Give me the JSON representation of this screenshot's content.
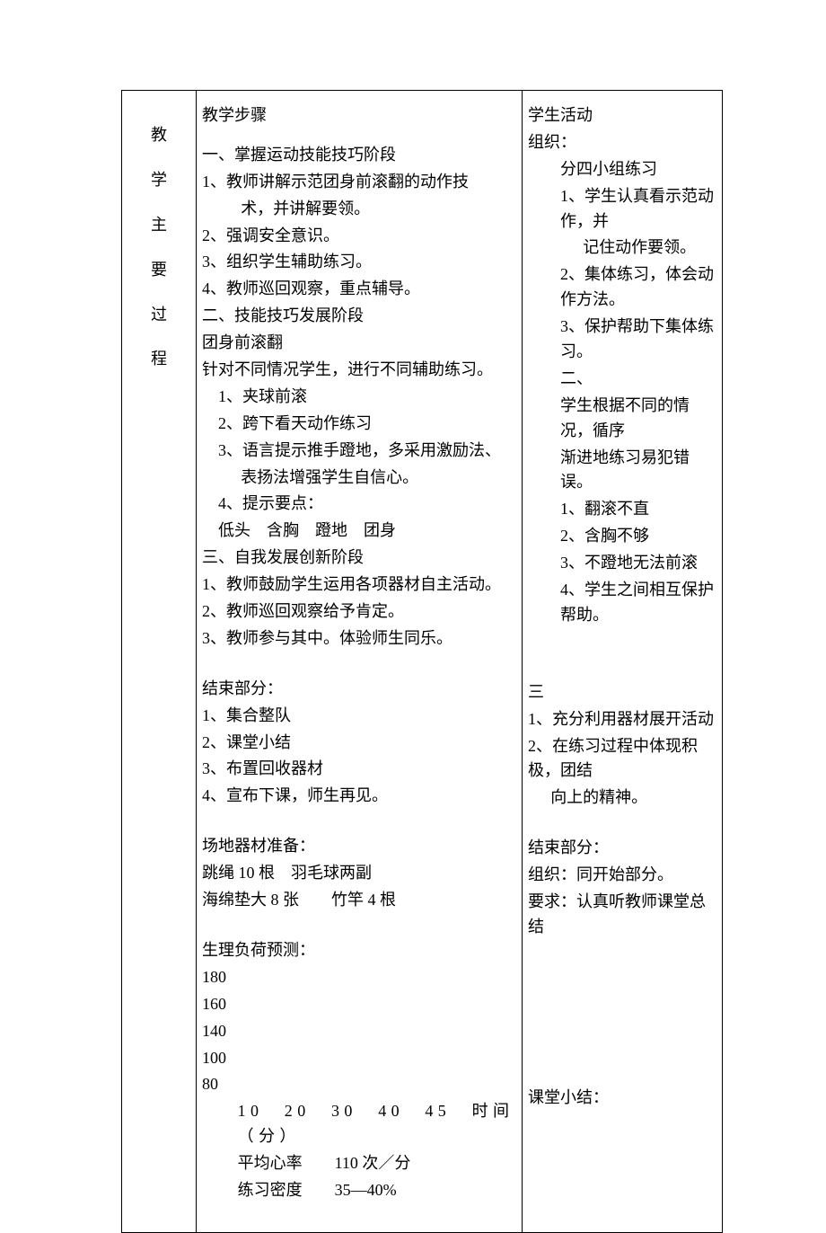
{
  "side": {
    "c1": "教",
    "c2": "学",
    "c3": "主",
    "c4": "要",
    "c5": "过",
    "c6": "程"
  },
  "mid": {
    "h_steps": "教学步骤",
    "s1_title": "一、掌握运动技能技巧阶段",
    "s1_1a": "1、教师讲解示范团身前滚翻的动作技",
    "s1_1b": "术，并讲解要领。",
    "s1_2": "2、强调安全意识。",
    "s1_3": "3、组织学生辅助练习。",
    "s1_4": "4、教师巡回观察，重点辅导。",
    "s2_title": "二、技能技巧发展阶段",
    "s2_sub": "团身前滚翻",
    "s2_intro": "针对不同情况学生，进行不同辅助练习。",
    "s2_1": "1、夹球前滚",
    "s2_2": "2、跨下看天动作练习",
    "s2_3a": "3、语言提示推手蹬地，多采用激励法、",
    "s2_3b": "表扬法增强学生自信心。",
    "s2_4": "4、提示要点：",
    "s2_points": "低头　含胸　蹬地　团身",
    "s3_title": "三、自我发展创新阶段",
    "s3_1": "1、教师鼓励学生运用各项器材自主活动。",
    "s3_2": "2、教师巡回观察给予肯定。",
    "s3_3": "3、教师参与其中。体验师生同乐。",
    "end_h": "结束部分：",
    "end_1": "1、集合整队",
    "end_2": "2、课堂小结",
    "end_3": "3、布置回收器材",
    "end_4": "4、宣布下课，师生再见。",
    "eq_h": "场地器材准备：",
    "eq_1": "跳绳 10 根　羽毛球两副",
    "eq_2": "海绵垫大 8 张　　竹竿 4 根",
    "load_h": "生理负荷预测：",
    "y180": "180",
    "y160": "160",
    "y140": "140",
    "y100": "100",
    "y80": "80",
    "xaxis": "10　20　30　40　45　时间（分）",
    "hr": "平均心率　　110 次／分",
    "dens": "练习密度　　35—40%"
  },
  "right": {
    "h_act": "学生活动",
    "org": "组织：",
    "org_groups": "分四小组练习",
    "a1_1a": "1、学生认真看示范动作，并",
    "a1_1b": "记住动作要领。",
    "a1_2": "2、集体练习，体会动作方法。",
    "a1_3": "3、保护帮助下集体练习。",
    "a2_title": "二、",
    "a2_intro1": "学生根据不同的情况，循序",
    "a2_intro2": "渐进地练习易犯错误。",
    "a2_1": "1、翻滚不直",
    "a2_2": "2、含胸不够",
    "a2_3": "3、不蹬地无法前滚",
    "a2_4": "4、学生之间相互保护帮助。",
    "a3_title": "三",
    "a3_1": "1、充分利用器材展开活动",
    "a3_2a": "2、在练习过程中体现积极，团结",
    "a3_2b": "向上的精神。",
    "end_h": "结束部分：",
    "end_org": "组织：同开始部分。",
    "end_req": "要求：认真听教师课堂总结",
    "summary": "课堂小结："
  },
  "chart_data": {
    "type": "line",
    "title": "生理负荷预测",
    "xlabel": "时间（分）",
    "ylabel": "",
    "x": [
      10,
      20,
      30,
      40,
      45
    ],
    "y_ticks": [
      80,
      100,
      140,
      160,
      180
    ],
    "ylim": [
      80,
      180
    ],
    "avg_heart_rate": "110 次／分",
    "exercise_density": "35—40%"
  }
}
